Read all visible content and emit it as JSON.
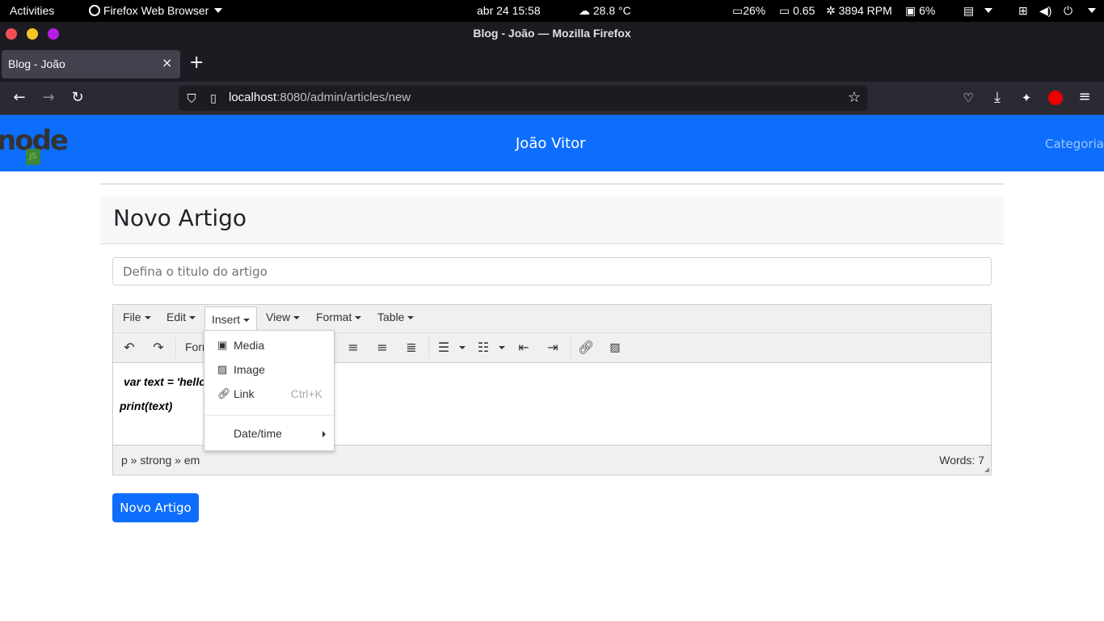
{
  "system_bar": {
    "activities": "Activities",
    "app_menu": "Firefox Web Browser",
    "datetime": "abr 24  15:58",
    "weather": "28.8 °C",
    "battery": "26%",
    "load": "0.65",
    "fan": "3894 RPM",
    "memory": "6%"
  },
  "browser": {
    "window_title": "Blog - João — Mozilla Firefox",
    "tab_title": "Blog - João",
    "url_host": "localhost",
    "url_path": ":8080/admin/articles/new"
  },
  "site": {
    "brand": "João Vitor",
    "nav_categorias": "Categorias",
    "logo_text": "node"
  },
  "page": {
    "heading": "Novo Artigo",
    "title_placeholder": "Defina o titulo do artigo",
    "submit_label": "Novo Artigo"
  },
  "editor": {
    "menus": [
      "File",
      "Edit",
      "Insert",
      "View",
      "Format",
      "Table"
    ],
    "toolbar_formats": "Forr",
    "content_line1": "var text = 'hello",
    "content_line2": "print(text)",
    "path": "p » strong » em",
    "word_count": "Words: 7"
  },
  "insert_menu": {
    "media": "Media",
    "image": "Image",
    "link": "Link",
    "link_shortcut": "Ctrl+K",
    "datetime": "Date/time"
  },
  "colors": {
    "header_blue": "#0d6efd",
    "browser_dark": "#1c1b22"
  }
}
